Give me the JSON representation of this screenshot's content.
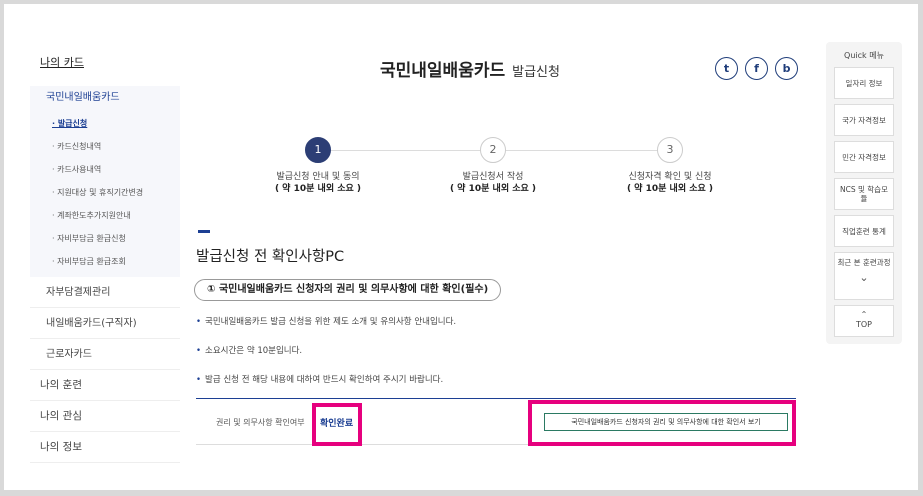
{
  "sidebar": {
    "top": "나의 카드",
    "card_head": "국민내일배움카드",
    "subitems": [
      "· 발급신청",
      "· 카드신청내역",
      "· 카드사용내역",
      "· 지원대상 및 휴직기간변경",
      "· 계좌한도추가지원안내",
      "· 자비부담금 환급신청",
      "· 자비부담금 환급조회"
    ],
    "items": [
      "자부담결제관리",
      "내일배움카드(구직자)",
      "근로자카드"
    ],
    "plain": [
      "나의 훈련",
      "나의 관심",
      "나의 정보"
    ]
  },
  "title": {
    "main": "국민내일배움카드",
    "sub": "발급신청"
  },
  "share": {
    "twitter": "t",
    "facebook": "f",
    "blog": "b"
  },
  "steps": [
    {
      "num": "1",
      "label": "발급신청 안내 및 동의",
      "time": "( 약 10분 내외 소요 )"
    },
    {
      "num": "2",
      "label": "발급신청서 작성",
      "time": "( 약 10분 내외 소요 )"
    },
    {
      "num": "3",
      "label": "신청자격 확인 및 신청",
      "time": "( 약 10분 내외 소요 )"
    }
  ],
  "section": {
    "title": "발급신청 전 확인사항PC",
    "pill": "① 국민내일배움카드 신청자의 권리 및 의무사항에 대한 확인(필수)",
    "notes": [
      "국민내일배움카드 발급 신청을 위한 제도 소개 및 유의사항 안내입니다.",
      "소요시간은 약 10분입니다.",
      "발급 신청 전 해당 내용에 대하여 반드시 확인하여 주시기 바랍니다."
    ]
  },
  "confirm": {
    "label": "권리 및 의무사항 확인여부",
    "status": "확인완료",
    "view_button": "국민내일배움카드 신청자의 권리 및 의무사항에 대한 확인서 보기"
  },
  "quick": {
    "title": "Quick 메뉴",
    "items": [
      "일자리 정보",
      "국가 자격정보",
      "민간 자격정보",
      "NCS 및 학습모듈",
      "직업훈련 통계"
    ],
    "recent": "최근 본 훈련과정",
    "top": "TOP"
  },
  "colors": {
    "accent": "#1c3f93",
    "highlight": "#e6007e",
    "step_active": "#2c3e75"
  }
}
